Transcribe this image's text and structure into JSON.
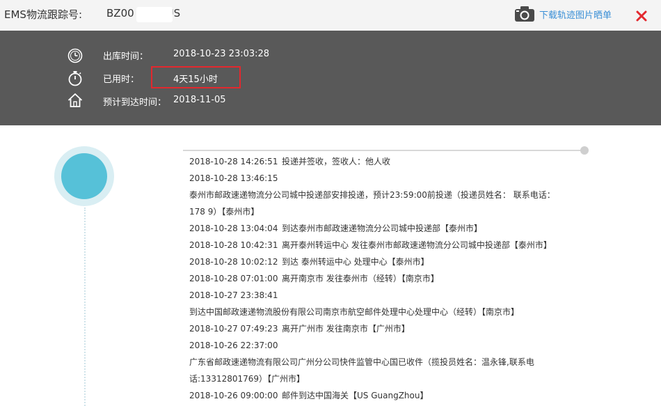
{
  "header": {
    "tracking_label": "EMS物流跟踪号:",
    "tracking_prefix": "BZ00",
    "tracking_suffix": "US",
    "download_label": "下载轨迹图片晒单"
  },
  "info": {
    "out_label": "出库时间：",
    "out_value": "2018-10-23 23:03:28",
    "used_label": "已用时：",
    "used_value": "4天15小时",
    "eta_label": "预计到达时间：",
    "eta_value": "2018-11-05"
  },
  "events": [
    {
      "time": "2018-10-28 14:26:51",
      "text": "投递并签收，签收人：他人收"
    },
    {
      "time": "2018-10-28 13:46:15",
      "text": ""
    },
    {
      "time": "",
      "text": "泰州市邮政速递物流分公司城中投递部安排投递，预计23:59:00前投递（投递员姓名：     联系电话："
    },
    {
      "time": "",
      "text": "178        9）【泰州市】"
    },
    {
      "time": "2018-10-28 13:04:04",
      "text": "到达泰州市邮政速递物流分公司城中投递部【泰州市】"
    },
    {
      "time": "2018-10-28 10:42:31",
      "text": "离开泰州转运中心 发往泰州市邮政速递物流分公司城中投递部【泰州市】"
    },
    {
      "time": "2018-10-28 10:02:12",
      "text": "到达 泰州转运中心 处理中心【泰州市】"
    },
    {
      "time": "2018-10-28 07:01:00",
      "text": "离开南京市 发往泰州市（经转）【南京市】"
    },
    {
      "time": "2018-10-27 23:38:41",
      "text": ""
    },
    {
      "time": "",
      "text": "到达中国邮政速递物流股份有限公司南京市航空邮件处理中心处理中心（经转）【南京市】"
    },
    {
      "time": "2018-10-27 07:49:23",
      "text": "离开广州市 发往南京市【广州市】"
    },
    {
      "time": "2018-10-26 22:37:00",
      "text": ""
    },
    {
      "time": "",
      "text": "广东省邮政速递物流有限公司广州分公司快件监管中心国已收件（揽投员姓名：温永锋,联系电"
    },
    {
      "time": "",
      "text": "话:13312801769）【广州市】"
    },
    {
      "time": "2018-10-26 09:00:00",
      "text": "邮件到达中国海关【US GuangZhou】"
    }
  ],
  "icons": {
    "camera": "camera-icon",
    "close": "close-icon",
    "clock": "clock-icon",
    "stopwatch": "stopwatch-icon",
    "home": "home-icon"
  },
  "colors": {
    "panel_bg": "#595959",
    "link": "#3a8fd6",
    "close": "#e3282e",
    "accent_dot": "#56c1d8",
    "highlight": "#e3282e"
  }
}
